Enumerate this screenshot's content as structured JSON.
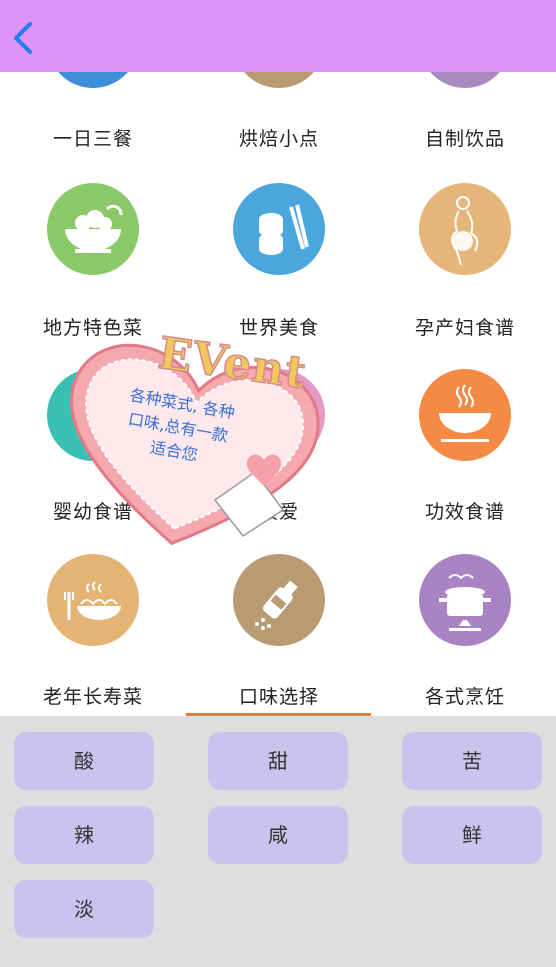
{
  "header": {
    "back_icon": "chevron-left-icon",
    "bg_color": "#df93f5",
    "icon_color": "#1e7ff0"
  },
  "categories": [
    {
      "label": "一日三餐",
      "icon": "meal-icon",
      "color": "#3f8fd8"
    },
    {
      "label": "烘焙小点",
      "icon": "bakery-icon",
      "color": "#b79a6f"
    },
    {
      "label": "自制饮品",
      "icon": "drink-icon",
      "color": "#a98ac0"
    },
    {
      "label": "地方特色菜",
      "icon": "bowl-icon",
      "color": "#8bc86a"
    },
    {
      "label": "世界美食",
      "icon": "sushi-icon",
      "color": "#4aa6dc"
    },
    {
      "label": "孕产妇食谱",
      "icon": "pregnant-icon",
      "color": "#e5b57a"
    },
    {
      "label": "婴幼食谱",
      "icon": "baby-food-icon",
      "color": "#3bbfb5"
    },
    {
      "label": "最爱",
      "icon": "favorite-icon",
      "color": "#e59ac4"
    },
    {
      "label": "功效食谱",
      "icon": "soup-bowl-icon",
      "color": "#f58a45"
    },
    {
      "label": "老年长寿菜",
      "icon": "noodles-icon",
      "color": "#e3b474"
    },
    {
      "label": "口味选择",
      "icon": "seasoning-bottle-icon",
      "color": "#b89b73"
    },
    {
      "label": "各式烹饪",
      "icon": "cooking-pot-icon",
      "color": "#a983c3"
    }
  ],
  "active_tab_color": "#f07b3f",
  "tastes": [
    "酸",
    "甜",
    "苦",
    "辣",
    "咸",
    "鲜",
    "淡"
  ],
  "event_popup": {
    "title": "EVent",
    "lines": [
      "各种菜式, 各种",
      "口味,总有一款",
      "适合您"
    ]
  }
}
